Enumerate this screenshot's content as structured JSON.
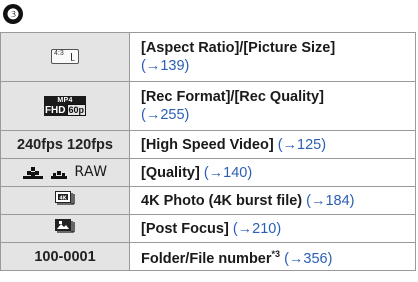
{
  "section_number": "❸",
  "rows": [
    {
      "icon_name": "aspect-ratio-picture-size-icon",
      "icon_text": {
        "ratio": "4:3",
        "size": "L"
      },
      "label_line1": "[Aspect Ratio]/[Picture Size]",
      "ref": "(→139)"
    },
    {
      "icon_name": "rec-format-quality-icon",
      "icon_text": {
        "format": "MP4",
        "res": "FHD",
        "rate": "60p"
      },
      "label_line1": "[Rec Format]/[Rec Quality]",
      "ref": "(→255)"
    },
    {
      "icon_text": "240fps 120fps",
      "label": "[High Speed Video]",
      "ref": "(→125)"
    },
    {
      "icon_name": "quality-icons",
      "icon_text": "RAW",
      "label": "[Quality]",
      "ref": "(→140)"
    },
    {
      "icon_name": "4k-photo-burst-icon",
      "label": "4K Photo (4K burst file)",
      "ref": "(→184)"
    },
    {
      "icon_name": "post-focus-icon",
      "label": "[Post Focus]",
      "ref": "(→210)"
    },
    {
      "icon_text": "100-0001",
      "label": "Folder/File number",
      "footnote": "*3",
      "ref": "(→356)"
    }
  ],
  "colors": {
    "link": "#2a5fb4",
    "icon_cell_bg": "#e4e4e4",
    "border": "#9a9a9a"
  }
}
